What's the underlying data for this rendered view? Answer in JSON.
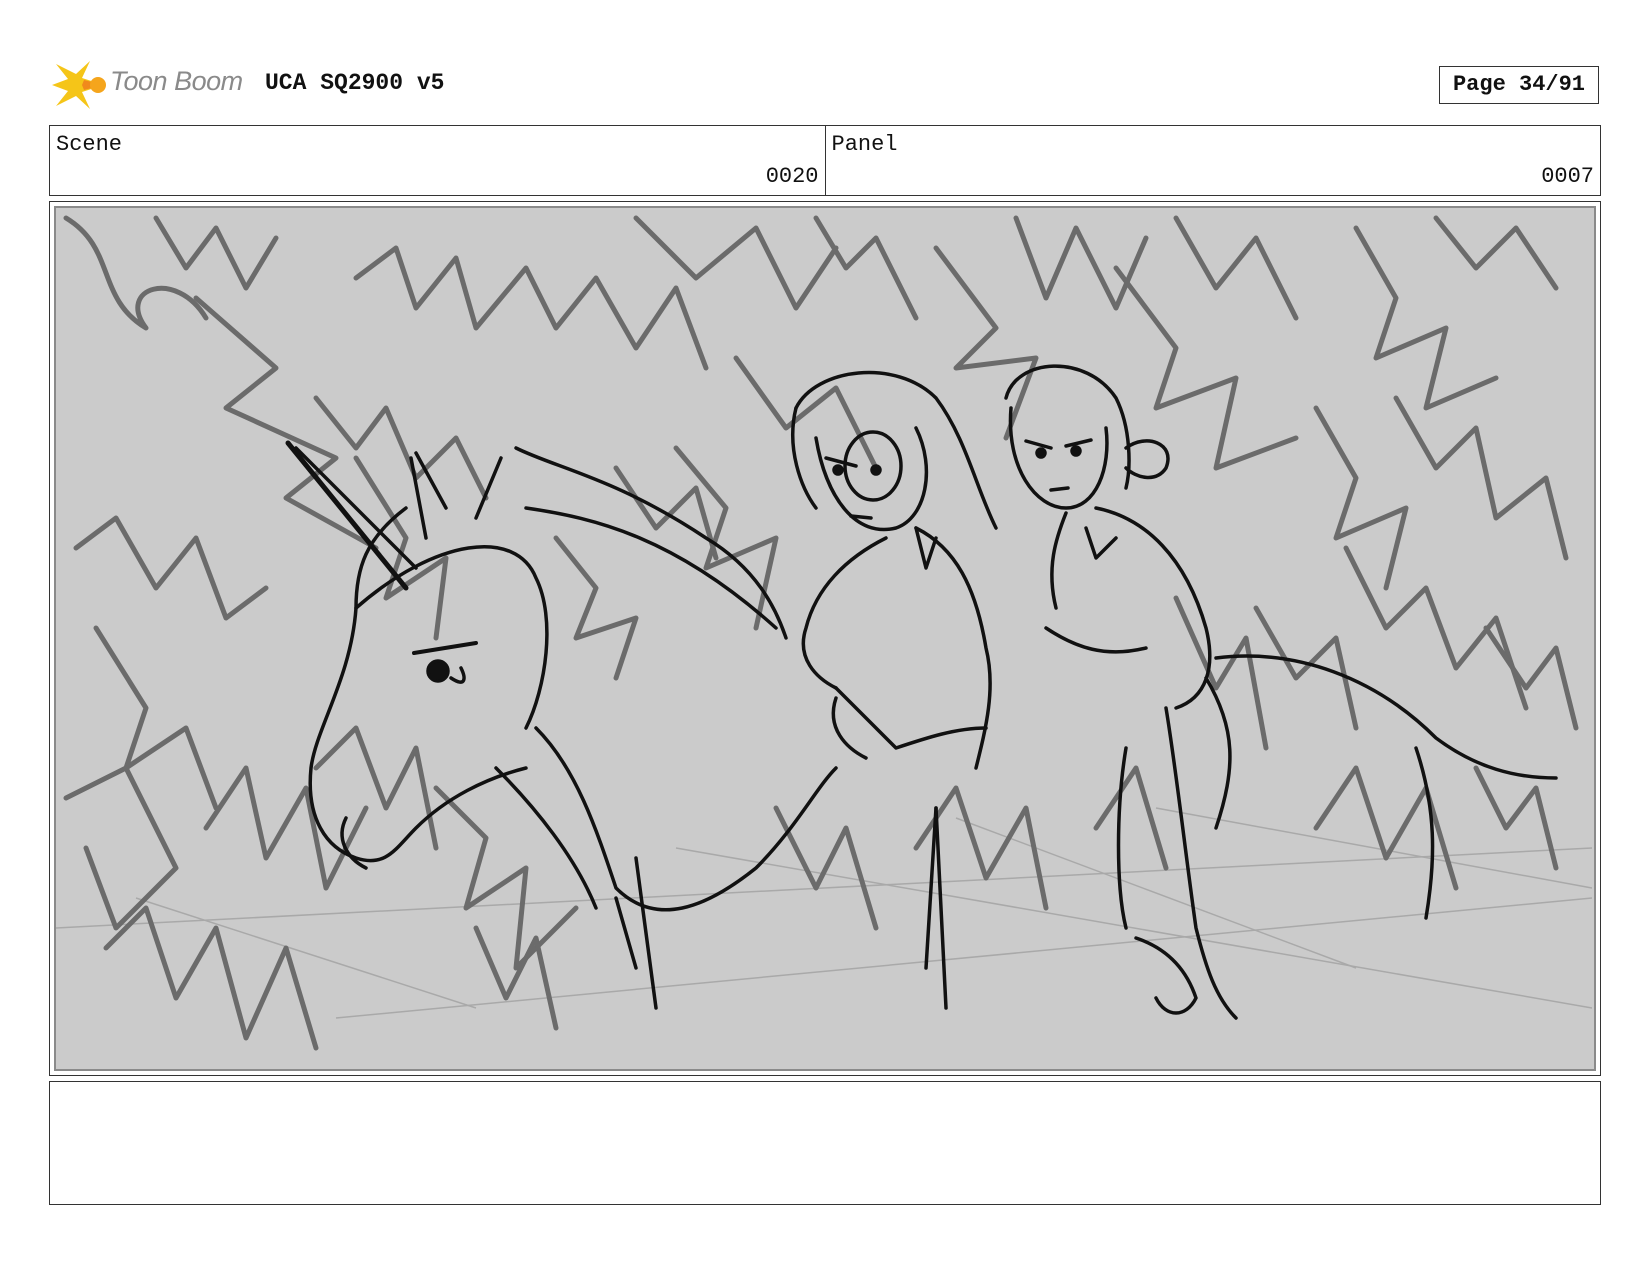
{
  "header": {
    "logo_text": "Toon Boom",
    "logo_icon": "toon-boom-star-icon",
    "doc_title": "UCA SQ2900 v5",
    "page_label": "Page 34/91"
  },
  "info": {
    "scene_label": "Scene",
    "scene_value": "0020",
    "panel_label": "Panel",
    "panel_value": "0007"
  },
  "sketch": {
    "background_color": "#cbcbcb",
    "tree_stroke_color": "#6b6b6b",
    "figure_stroke_color": "#111111"
  },
  "caption": {
    "text": ""
  }
}
